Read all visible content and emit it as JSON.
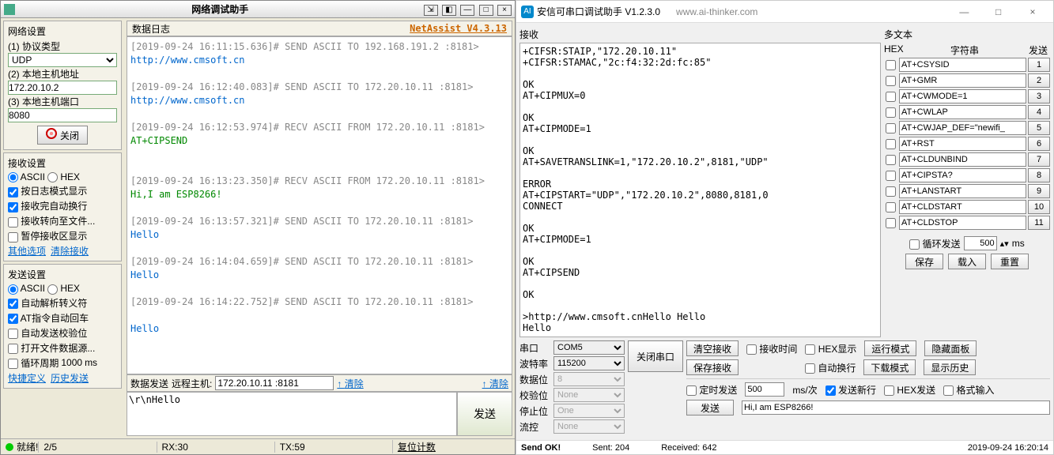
{
  "left": {
    "title": "网络调试助手",
    "net": {
      "group": "网络设置",
      "proto_label": "(1) 协议类型",
      "proto": "UDP",
      "host_label": "(2) 本地主机地址",
      "host": "172.20.10.2",
      "port_label": "(3) 本地主机端口",
      "port": "8080",
      "close_btn": "关闭"
    },
    "recvset": {
      "group": "接收设置",
      "ascii": "ASCII",
      "hex": "HEX",
      "logmode": "按日志模式显示",
      "autowrap": "接收完自动换行",
      "tofile": "接收转向至文件...",
      "pause": "暂停接收区显示",
      "more": "其他选项",
      "clear": "清除接收"
    },
    "sendset": {
      "group": "发送设置",
      "ascii": "ASCII",
      "hex": "HEX",
      "escape": "自动解析转义符",
      "atcr": "AT指令自动回车",
      "checksum": "自动发送校验位",
      "openfile": "打开文件数据源...",
      "cycle": "循环周期",
      "cycle_val": "1000",
      "cycle_unit": "ms",
      "quick": "快捷定义",
      "history": "历史发送"
    },
    "log_title": "数据日志",
    "version": "NetAssist V4.3.13",
    "log": [
      {
        "t": "g",
        "v": "[2019-09-24 16:11:15.636]# SEND ASCII TO 192.168.191.2 :8181>"
      },
      {
        "t": "b",
        "v": "http://www.cmsoft.cn"
      },
      {
        "t": "",
        "v": ""
      },
      {
        "t": "g",
        "v": "[2019-09-24 16:12:40.083]# SEND ASCII TO 172.20.10.11 :8181>"
      },
      {
        "t": "b",
        "v": "http://www.cmsoft.cn"
      },
      {
        "t": "",
        "v": ""
      },
      {
        "t": "g",
        "v": "[2019-09-24 16:12:53.974]# RECV ASCII FROM 172.20.10.11 :8181>"
      },
      {
        "t": "gn",
        "v": "AT+CIPSEND"
      },
      {
        "t": "",
        "v": ""
      },
      {
        "t": "",
        "v": ""
      },
      {
        "t": "g",
        "v": "[2019-09-24 16:13:23.350]# RECV ASCII FROM 172.20.10.11 :8181>"
      },
      {
        "t": "gn",
        "v": "Hi,I am ESP8266!"
      },
      {
        "t": "",
        "v": ""
      },
      {
        "t": "g",
        "v": "[2019-09-24 16:13:57.321]# SEND ASCII TO 172.20.10.11 :8181>"
      },
      {
        "t": "b",
        "v": "Hello"
      },
      {
        "t": "",
        "v": ""
      },
      {
        "t": "g",
        "v": "[2019-09-24 16:14:04.659]# SEND ASCII TO 172.20.10.11 :8181>"
      },
      {
        "t": "b",
        "v": "Hello"
      },
      {
        "t": "",
        "v": ""
      },
      {
        "t": "g",
        "v": "[2019-09-24 16:14:22.752]# SEND ASCII TO 172.20.10.11 :8181>"
      },
      {
        "t": "",
        "v": ""
      },
      {
        "t": "b",
        "v": "Hello"
      }
    ],
    "sendhdr": {
      "label": "数据发送",
      "remote_label": "远程主机:",
      "remote": "172.20.10.11 :8181",
      "clear_up": "清除",
      "clear_btn": "清除"
    },
    "sendtext": "\\r\\nHello",
    "send_btn": "发送",
    "status": {
      "ready": "就绪!",
      "pages": "2/5",
      "rx": "RX:30",
      "tx": "TX:59",
      "reset": "复位计数"
    }
  },
  "right": {
    "title": "安信可串口调试助手 V1.2.3.0",
    "url": "www.ai-thinker.com",
    "recv_label": "接收",
    "recv_text": "+CIFSR:STAIP,\"172.20.10.11\"\n+CIFSR:STAMAC,\"2c:f4:32:2d:fc:85\"\n\nOK\nAT+CIPMUX=0\n\nOK\nAT+CIPMODE=1\n\nOK\nAT+SAVETRANSLINK=1,\"172.20.10.2\",8181,\"UDP\"\n\nERROR\nAT+CIPSTART=\"UDP\",\"172.20.10.2\",8080,8181,0\nCONNECT\n\nOK\nAT+CIPMODE=1\n\nOK\nAT+CIPSEND\n\nOK\n\n>http://www.cmsoft.cnHello Hello\nHello",
    "multi": {
      "label": "多文本",
      "h_hex": "HEX",
      "h_str": "字符串",
      "h_send": "发送",
      "rows": [
        {
          "cmd": "AT+CSYSID",
          "n": "1"
        },
        {
          "cmd": "AT+GMR",
          "n": "2"
        },
        {
          "cmd": "AT+CWMODE=1",
          "n": "3"
        },
        {
          "cmd": "AT+CWLAP",
          "n": "4"
        },
        {
          "cmd": "AT+CWJAP_DEF=\"newifi_",
          "n": "5"
        },
        {
          "cmd": "AT+RST",
          "n": "6"
        },
        {
          "cmd": "AT+CLDUNBIND",
          "n": "7"
        },
        {
          "cmd": "AT+CIPSTA?",
          "n": "8"
        },
        {
          "cmd": "AT+LANSTART",
          "n": "9"
        },
        {
          "cmd": "AT+CLDSTART",
          "n": "10"
        },
        {
          "cmd": "AT+CLDSTOP",
          "n": "11"
        }
      ],
      "loop_label": "循环发送",
      "loop_val": "500",
      "loop_unit": "ms",
      "save": "保存",
      "load": "载入",
      "reset": "重置"
    },
    "serial": {
      "port_l": "串口",
      "port": "COM5",
      "baud_l": "波特率",
      "baud": "115200",
      "data_l": "数据位",
      "data": "8",
      "chk_l": "校验位",
      "chk": "None",
      "stop_l": "停止位",
      "stop": "One",
      "flow_l": "流控",
      "flow": "None"
    },
    "close_port": "关闭串口",
    "opts": {
      "clear_recv": "清空接收",
      "save_recv": "保存接收",
      "recv_time": "接收时间",
      "hex_show": "HEX显示",
      "auto_wrap": "自动换行",
      "run_mode": "运行模式",
      "dl_mode": "下载模式",
      "hide_panel": "隐藏面板",
      "show_hist": "显示历史",
      "timed_send": "定时发送",
      "timed_val": "500",
      "timed_unit": "ms/次",
      "send_nl": "发送新行",
      "hex_send": "HEX发送",
      "fmt_in": "格式输入",
      "send_btn": "发送",
      "send_text": "Hi,I am ESP8266!"
    },
    "status": {
      "sent": "Send OK!",
      "sent2": "Sent: 204",
      "recv": "Received: 642",
      "time": "2019-09-24 16:20:14"
    }
  }
}
